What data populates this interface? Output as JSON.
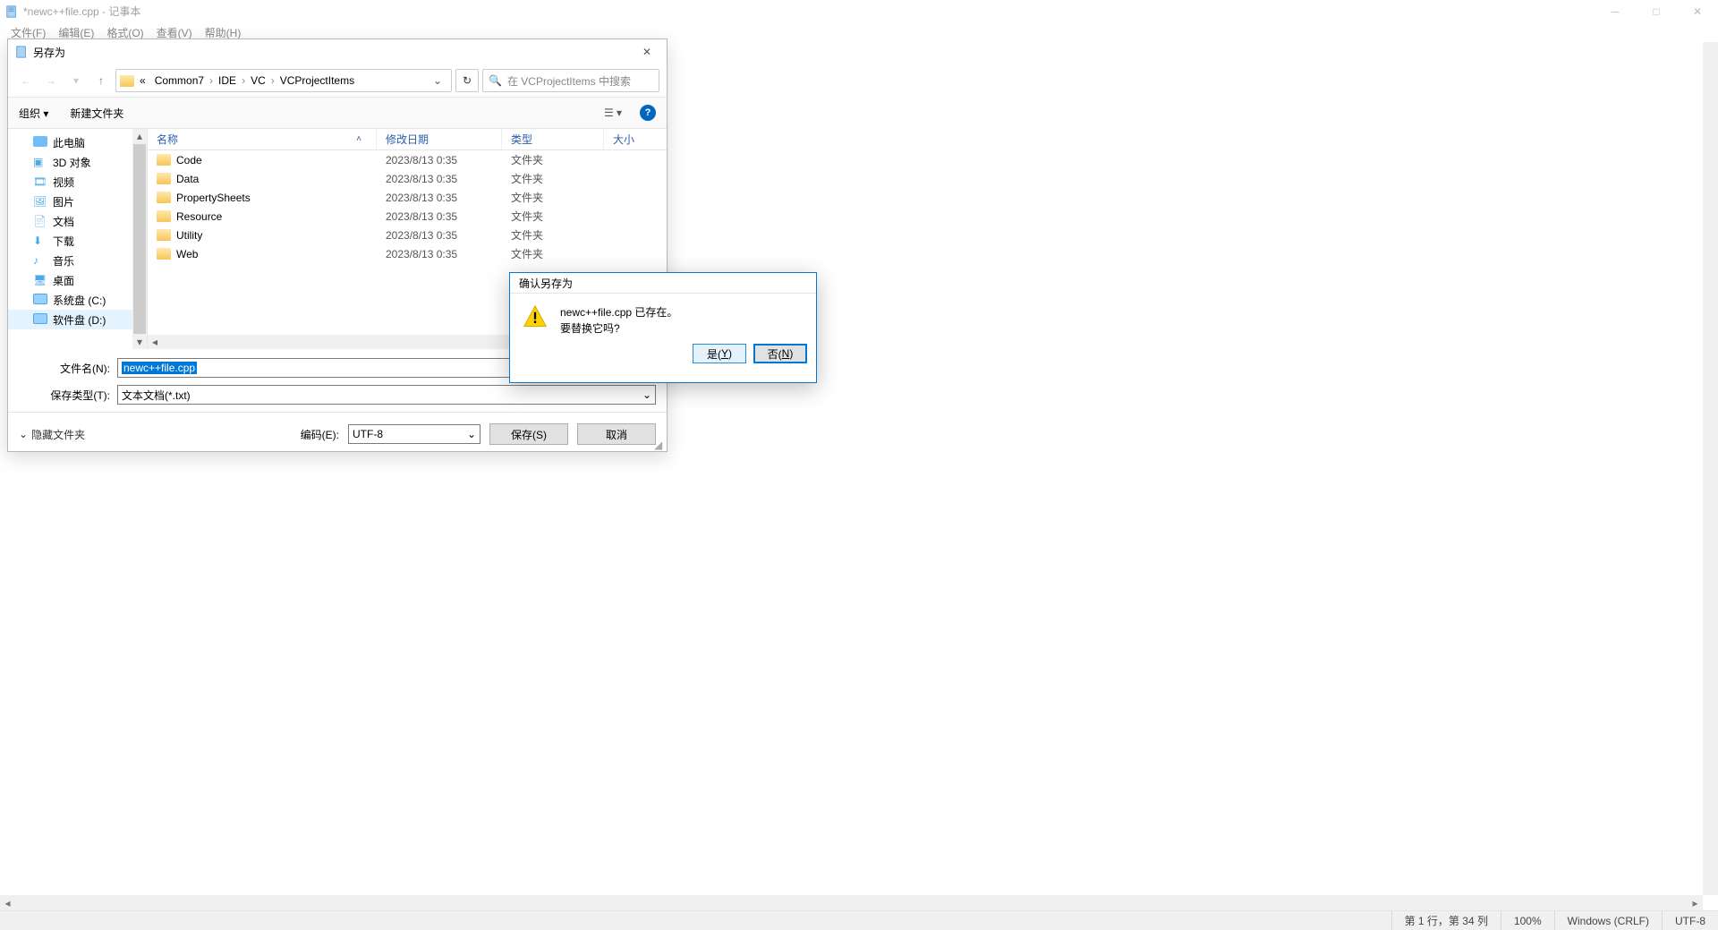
{
  "notepad": {
    "title": "*newc++file.cpp - 记事本",
    "menu": [
      "文件(F)",
      "编辑(E)",
      "格式(O)",
      "查看(V)",
      "帮助(H)"
    ],
    "status": {
      "pos": "第 1 行，第 34 列",
      "zoom": "100%",
      "eol": "Windows (CRLF)",
      "enc": "UTF-8"
    }
  },
  "saveas": {
    "title": "另存为",
    "breadcrumbs": [
      "«",
      "Common7",
      "IDE",
      "VC",
      "VCProjectItems"
    ],
    "search_placeholder": "在 VCProjectItems 中搜索",
    "toolbar": {
      "organize": "组织 ▾",
      "newfolder": "新建文件夹"
    },
    "tree": [
      {
        "label": "此电脑",
        "icon": "pc"
      },
      {
        "label": "3D 对象",
        "icon": "3d"
      },
      {
        "label": "视频",
        "icon": "video"
      },
      {
        "label": "图片",
        "icon": "pic"
      },
      {
        "label": "文档",
        "icon": "doc"
      },
      {
        "label": "下载",
        "icon": "dl"
      },
      {
        "label": "音乐",
        "icon": "music"
      },
      {
        "label": "桌面",
        "icon": "desk"
      },
      {
        "label": "系统盘 (C:)",
        "icon": "disk"
      },
      {
        "label": "软件盘 (D:)",
        "icon": "disk",
        "selected": true
      }
    ],
    "columns": {
      "name": "名称",
      "date": "修改日期",
      "type": "类型",
      "size": "大小"
    },
    "rows": [
      {
        "name": "Code",
        "date": "2023/8/13 0:35",
        "type": "文件夹"
      },
      {
        "name": "Data",
        "date": "2023/8/13 0:35",
        "type": "文件夹"
      },
      {
        "name": "PropertySheets",
        "date": "2023/8/13 0:35",
        "type": "文件夹"
      },
      {
        "name": "Resource",
        "date": "2023/8/13 0:35",
        "type": "文件夹"
      },
      {
        "name": "Utility",
        "date": "2023/8/13 0:35",
        "type": "文件夹"
      },
      {
        "name": "Web",
        "date": "2023/8/13 0:35",
        "type": "文件夹"
      }
    ],
    "filename_label": "文件名(N):",
    "filename_value": "newc++file.cpp",
    "filetype_label": "保存类型(T):",
    "filetype_value": "文本文档(*.txt)",
    "hide_folders": "隐藏文件夹",
    "encoding_label": "编码(E):",
    "encoding_value": "UTF-8",
    "save_btn": "保存(S)",
    "cancel_btn": "取消"
  },
  "confirm": {
    "title": "确认另存为",
    "line1": "newc++file.cpp 已存在。",
    "line2": "要替换它吗?",
    "yes": "是(Y)",
    "no": "否(N)"
  }
}
